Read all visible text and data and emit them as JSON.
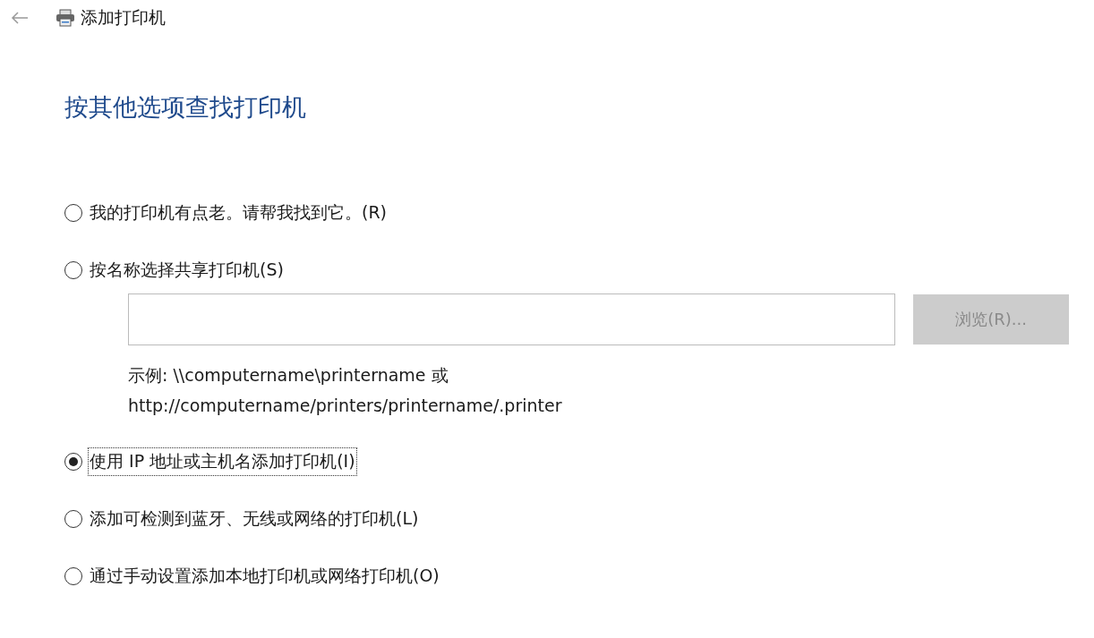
{
  "window": {
    "title": "添加打印机"
  },
  "heading": "按其他选项查找打印机",
  "options": [
    {
      "label": "我的打印机有点老。请帮我找到它。(R)",
      "selected": false,
      "focused": false
    },
    {
      "label": "按名称选择共享打印机(S)",
      "selected": false,
      "focused": false,
      "share": {
        "browse_button": {
          "label": "浏览(R)...",
          "disabled": true
        },
        "example_lines": [
          "示例: \\\\computername\\printername 或",
          "http://computername/printers/printername/.printer"
        ]
      }
    },
    {
      "label": "使用 IP 地址或主机名添加打印机(I)",
      "selected": true,
      "focused": true
    },
    {
      "label": "添加可检测到蓝牙、无线或网络的打印机(L)",
      "selected": false,
      "focused": false
    },
    {
      "label": "通过手动设置添加本地打印机或网络打印机(O)",
      "selected": false,
      "focused": false
    }
  ]
}
